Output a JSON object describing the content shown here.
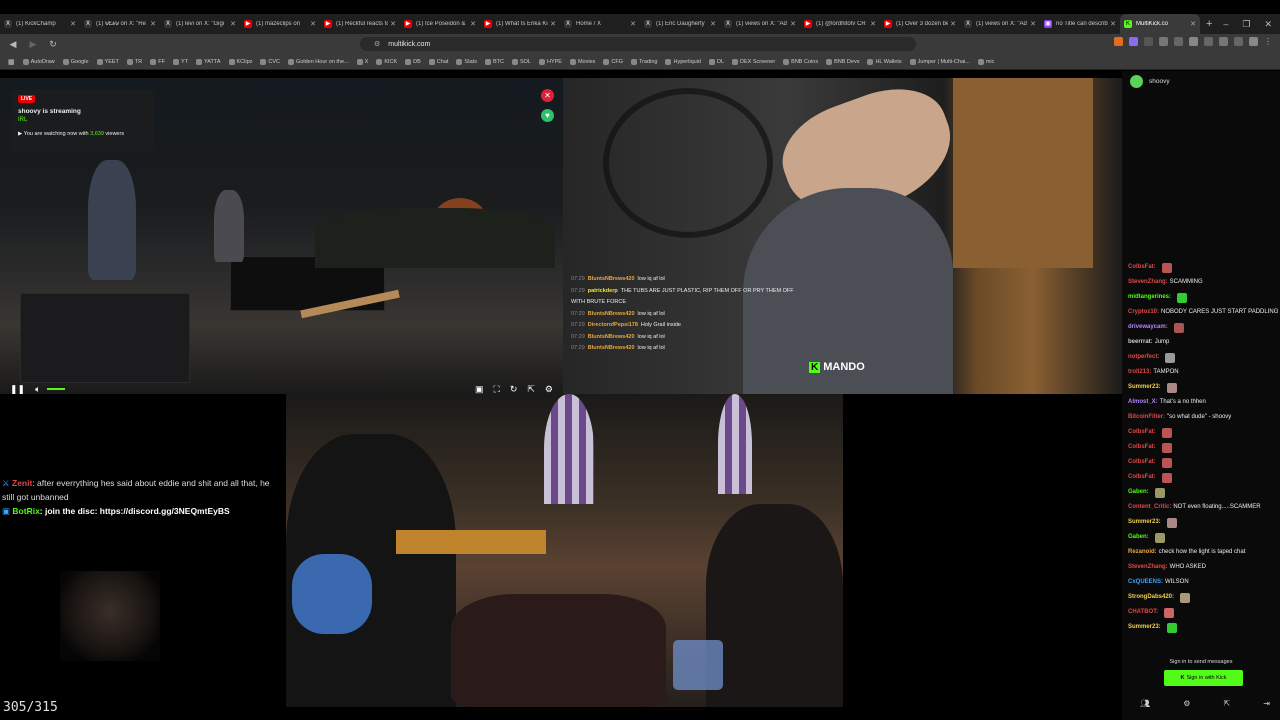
{
  "browser": {
    "tabs": [
      {
        "title": "(1) KickChamp",
        "fav": "X",
        "color": "#333"
      },
      {
        "title": "(1) ѡ£ѧѡ on X: \"Re",
        "fav": "X",
        "color": "#333"
      },
      {
        "title": "(1) levi on X: \"Gigi",
        "fav": "X",
        "color": "#333"
      },
      {
        "title": "(1) mazeclips on",
        "fav": "▶",
        "color": "#e00"
      },
      {
        "title": "(1) Reckful reacts to",
        "fav": "▶",
        "color": "#e00"
      },
      {
        "title": "(1) Ice Poseidon & ",
        "fav": "▶",
        "color": "#e00"
      },
      {
        "title": "(1) What Is Erika Kir",
        "fav": "▶",
        "color": "#e00"
      },
      {
        "title": "Home / X",
        "fav": "X",
        "color": "#333"
      },
      {
        "title": "(1) Eric Daugherty",
        "fav": "X",
        "color": "#333"
      },
      {
        "title": "(1) views on X: \"Ad",
        "fav": "X",
        "color": "#333"
      },
      {
        "title": "(1) @lordhitotv CR",
        "fav": "▶",
        "color": "#e00"
      },
      {
        "title": "(1) Over 3 dozen be",
        "fav": "▶",
        "color": "#e00"
      },
      {
        "title": "(1) views on X: \"Ad",
        "fav": "X",
        "color": "#333"
      },
      {
        "title": "no Title can describ",
        "fav": "▣",
        "color": "#8a3ff0"
      }
    ],
    "active_tab": {
      "title": "MultiKick.co",
      "fav": "K",
      "color": "#53fc18"
    },
    "url": "multikick.com",
    "bookmarks": [
      "AutoDraw",
      "Google",
      "YEET",
      "TR",
      "FF",
      "YT",
      "YATTA",
      "KClipz",
      "CVC",
      "Golden Hour on the...",
      "X",
      "KICK",
      "DB",
      "Chat",
      "Stats",
      "BTC",
      "SOL",
      "HYPE",
      "Movies",
      "CFG",
      "Trading",
      "Hyperliquid",
      "DL",
      "DEX Screener",
      "BNB Coins",
      "BNB Devs",
      "HL Wallets",
      "Jumper | Multi-Chai...",
      "mic"
    ]
  },
  "player1": {
    "live": "LIVE",
    "streamer": "shoovy is streaming",
    "category": "IRL",
    "watching_prefix": "You are watching now with",
    "viewers": "3,639",
    "viewers_suffix": "viewers",
    "icons": [
      "pause-icon",
      "volume-icon",
      "pip-icon",
      "fullscreen-icon",
      "reload-icon",
      "popout-icon",
      "settings-icon"
    ]
  },
  "player2": {
    "chat": [
      {
        "t": "07:29",
        "u": "BluntsNBrews420",
        "c": "#e7a93c",
        "m": "low iq af lol"
      },
      {
        "t": "07:29",
        "u": "patrickderp",
        "c": "#f0e43c",
        "m": "THE TUBS ARE JUST PLASTIC, RIP THEM OFF OR PRY THEM OFF WITH BRUTE FORCE"
      },
      {
        "t": "07:29",
        "u": "BluntsNBrews420",
        "c": "#e7a93c",
        "m": "low iq af lol"
      },
      {
        "t": "07:29",
        "u": "DirectorofPepsi178",
        "c": "#e7a93c",
        "m": "Holy Grail inside"
      },
      {
        "t": "07:29",
        "u": "BluntsNBrews420",
        "c": "#e7a93c",
        "m": "low iq af lol"
      },
      {
        "t": "07:29",
        "u": "BluntsNBrews420",
        "c": "#e7a93c",
        "m": "low iq af lol"
      }
    ],
    "overlay": "MANDO",
    "overlay_k": "K"
  },
  "left_chat": {
    "line1_user": "Zenit",
    "line1_msg": ": after everrything hes said about eddie and shit and all that, he still got unbanned",
    "line2_user": "BotRix",
    "line2_msg": ": join the disc: https://discord.gg/3NEQmtEyBS"
  },
  "counter": "305/315",
  "side_chat": {
    "channel": "shoovy",
    "messages": [
      {
        "u": "ColbsFat:",
        "c": "#e04848",
        "m": "",
        "e": "#b55"
      },
      {
        "u": "StevenZhang:",
        "c": "#e04848",
        "m": "SCAMMING",
        "e": ""
      },
      {
        "u": "midtangerines:",
        "c": "#53fc18",
        "m": "",
        "e": "#3c3"
      },
      {
        "u": "Cryptoz10:",
        "c": "#e04848",
        "m": "NOBODY CARES JUST START PADDLING",
        "e": ""
      },
      {
        "u": "drivewaycam:",
        "c": "#b585ff",
        "m": "",
        "e": "#a55"
      },
      {
        "u": "beerrrat:",
        "c": "#cccccc",
        "m": "Jump",
        "e": ""
      },
      {
        "u": "notperfect:",
        "c": "#e04848",
        "m": "",
        "e": "#999"
      },
      {
        "u": "troll213:",
        "c": "#e04848",
        "m": "TAMPON",
        "e": ""
      },
      {
        "u": "Summer23:",
        "c": "#f0d050",
        "m": "",
        "e": "#a88"
      },
      {
        "u": "Almost_X:",
        "c": "#b585ff",
        "m": "That's a no thhen",
        "e": ""
      },
      {
        "u": "BitcoinFilter:",
        "c": "#e04848",
        "m": "\"so what dude\" - shoovy",
        "e": ""
      },
      {
        "u": "ColbsFat:",
        "c": "#e04848",
        "m": "",
        "e": "#b55"
      },
      {
        "u": "ColbsFat:",
        "c": "#e04848",
        "m": "",
        "e": "#b55"
      },
      {
        "u": "ColbsFat:",
        "c": "#e04848",
        "m": "",
        "e": "#b55"
      },
      {
        "u": "ColbsFat:",
        "c": "#e04848",
        "m": "",
        "e": "#b55"
      },
      {
        "u": "Gaben:",
        "c": "#53fc18",
        "m": "",
        "e": "#996"
      },
      {
        "u": "Content_Critic:",
        "c": "#e04848",
        "m": "NOT even floating.....SCAMMER",
        "e": ""
      },
      {
        "u": "Summer23:",
        "c": "#f0d050",
        "m": "",
        "e": "#a88"
      },
      {
        "u": "Gaben:",
        "c": "#53fc18",
        "m": "",
        "e": "#996"
      },
      {
        "u": "Rezanoid:",
        "c": "#e7a93c",
        "m": "check how the light is taped chat",
        "e": ""
      },
      {
        "u": "StevenZhang:",
        "c": "#e04848",
        "m": "WHO ASKED",
        "e": ""
      },
      {
        "u": "CxQUEENS:",
        "c": "#3fa2ff",
        "m": "WILSON",
        "e": ""
      },
      {
        "u": "StrongDabs420:",
        "c": "#f0d050",
        "m": "",
        "e": "#a97"
      },
      {
        "u": "CHATBOT:",
        "c": "#e04848",
        "m": "",
        "e": "#c66"
      },
      {
        "u": "Summer23:",
        "c": "#f0d050",
        "m": "",
        "e": "#3c3"
      }
    ],
    "signin_text": "Sign in to send messages",
    "signin_button": "Sign in with Kick"
  }
}
